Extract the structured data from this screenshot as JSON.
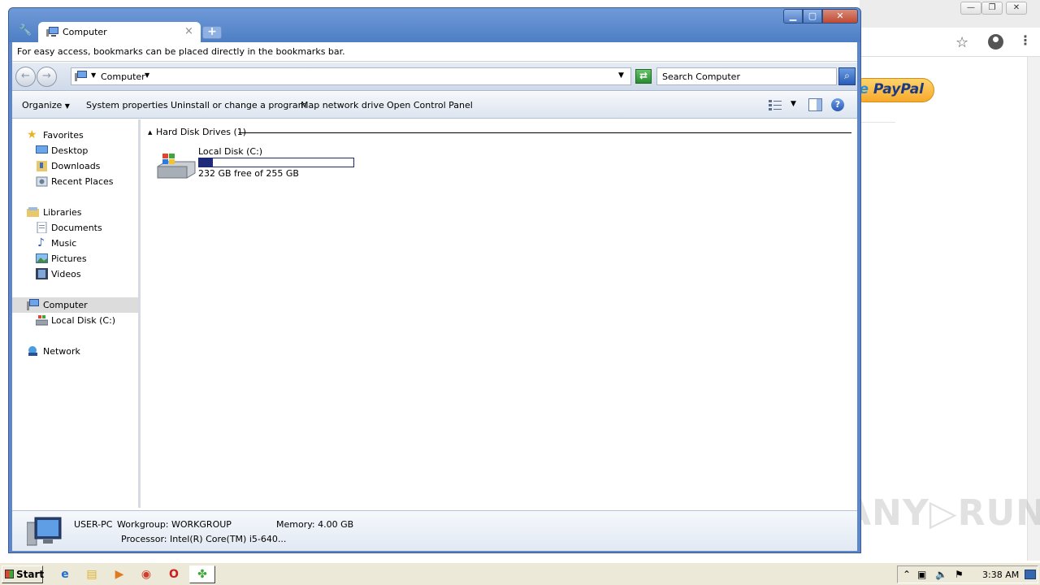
{
  "explorer": {
    "tab_title": "Computer",
    "bookmark_hint": "For easy access, bookmarks can be placed directly in the bookmarks bar.",
    "address": "Computer",
    "search_placeholder": "Search Computer",
    "commands": [
      "Organize",
      "System properties",
      "Uninstall or change a program",
      "Map network drive",
      "Open Control Panel"
    ],
    "nav": {
      "favorites": "Favorites",
      "desktop": "Desktop",
      "downloads": "Downloads",
      "recent": "Recent Places",
      "libraries": "Libraries",
      "documents": "Documents",
      "music": "Music",
      "pictures": "Pictures",
      "videos": "Videos",
      "computer": "Computer",
      "local_disk": "Local Disk (C:)",
      "network": "Network"
    },
    "group_label": "Hard Disk Drives (1)",
    "drive": {
      "name": "Local Disk (C:)",
      "free_text": "232 GB free of 255 GB",
      "used_fraction": 0.09
    },
    "details": {
      "pc_name": "USER-PC",
      "workgroup": "Workgroup: WORKGROUP",
      "memory": "Memory: 4.00 GB",
      "processor": "Processor: Intel(R) Core(TM) i5-640..."
    }
  },
  "background": {
    "paypal_text": "PayPal"
  },
  "taskbar": {
    "start_label": "Start",
    "clock": "3:38 AM"
  },
  "colors": {
    "window_frame": "#5d87c9",
    "drive_fill": "#1e2a7a",
    "selected_nav": "#dcdcdc",
    "taskbar": "#ece9d8"
  }
}
